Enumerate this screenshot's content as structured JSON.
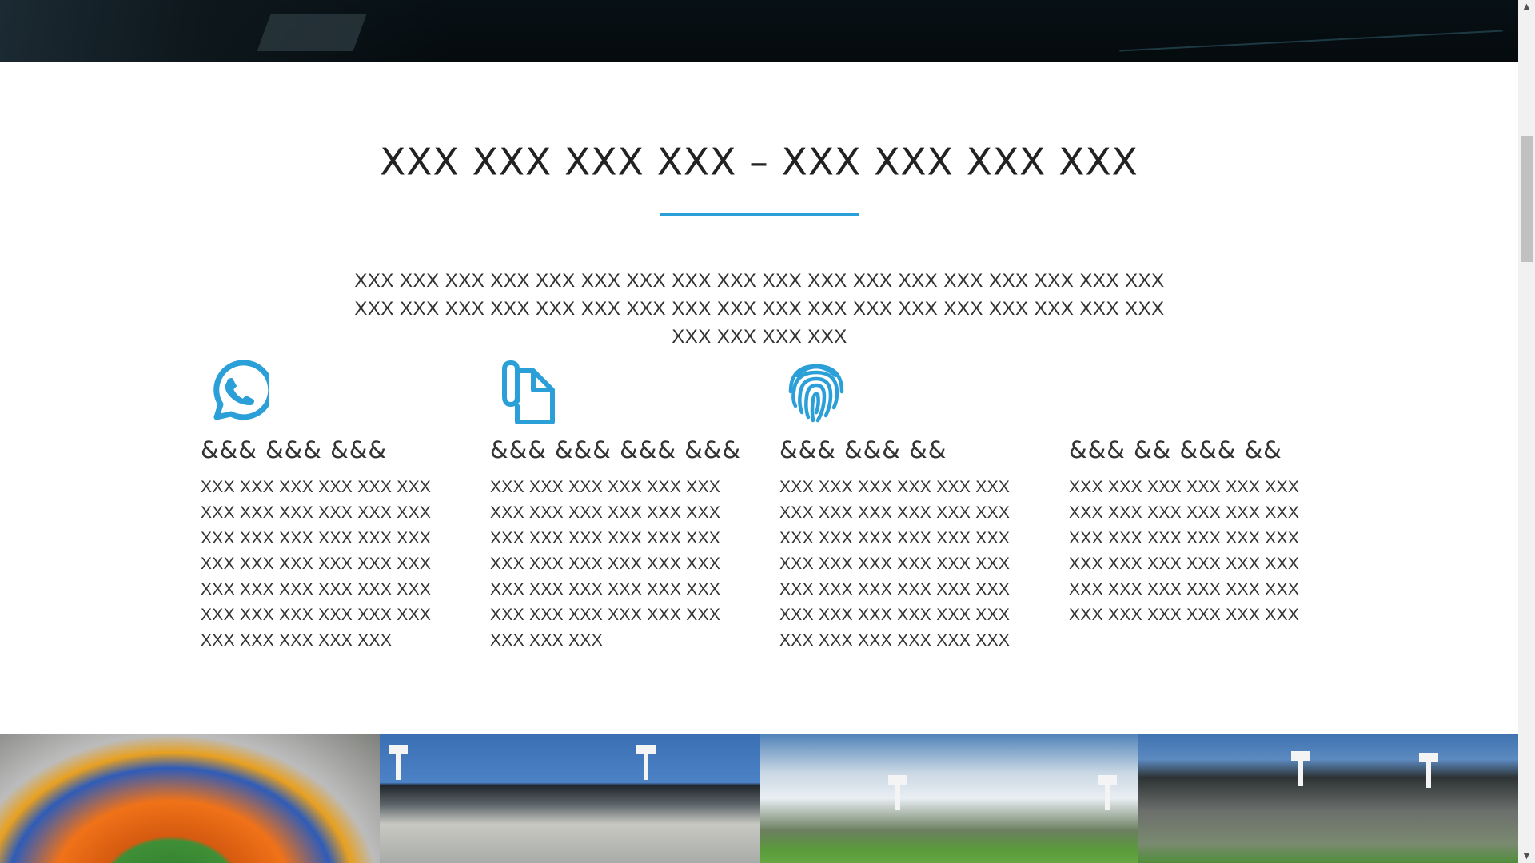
{
  "features_section": {
    "title": "XXX XXX XXX XXX – XXX XXX XXX XXX",
    "intro": "XXX XXX XXX XXX XXX XXX XXX XXX XXX XXX XXX XXX XXX XXX XXX XXX XXX XXX XXX XXX XXX XXX XXX XXX XXX XXX XXX XXX XXX XXX XXX XXX XXX XXX XXX XXX XXX XXX XXX XXX",
    "accent_color": "#2b9fd8",
    "features": [
      {
        "icon": "whatsapp-icon",
        "heading": "&&& &&& &&&",
        "text": "XXX XXX XXX XXX XXX XXX XXX XXX XXX XXX XXX XXX XXX XXX XXX XXX XXX XXX XXX XXX XXX XXX XXX XXX XXX XXX XXX XXX XXX XXX XXX XXX XXX XXX XXX XXX XXX XXX XXX XXX XXX"
      },
      {
        "icon": "attachment-document-icon",
        "heading": "&&& &&& &&& &&&",
        "text": "XXX XXX XXX XXX XXX XXX XXX XXX XXX XXX XXX XXX XXX XXX XXX XXX XXX XXX XXX XXX XXX XXX XXX XXX XXX XXX XXX XXX XXX XXX XXX XXX XXX XXX XXX XXX XXX XXX XXX"
      },
      {
        "icon": "fingerprint-icon",
        "heading": "&&& &&& &&",
        "text": "XXX XXX XXX XXX XXX XXX XXX XXX XXX XXX XXX XXX XXX XXX XXX XXX XXX XXX XXX XXX XXX XXX XXX XXX XXX XXX XXX XXX XXX XXX XXX XXX XXX XXX XXX XXX XXX XXX XXX XXX XXX XXX"
      },
      {
        "icon": "",
        "heading": "&&& && &&& &&",
        "text": "XXX XXX XXX XXX XXX XXX XXX XXX XXX XXX XXX XXX XXX XXX XXX XXX XXX XXX XXX XXX XXX XXX XXX XXX XXX XXX XXX XXX XXX XXX XXX XXX XXX XXX XXX XXX"
      }
    ]
  },
  "gallery": {
    "images": [
      "stadium-aerial-photo",
      "stadium-stands-photo",
      "cricket-ground-photo",
      "stadium-crowd-photo"
    ]
  }
}
